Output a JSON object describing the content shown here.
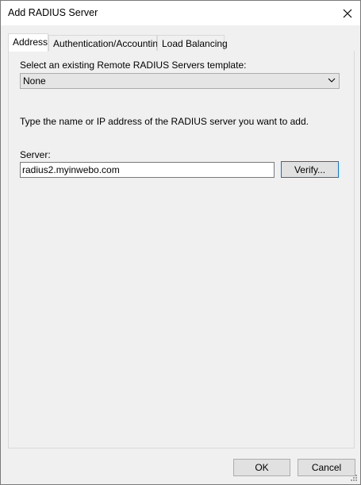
{
  "window": {
    "title": "Add RADIUS Server"
  },
  "tabs": [
    {
      "label": "Address",
      "active": true
    },
    {
      "label": "Authentication/Accounting",
      "active": false
    },
    {
      "label": "Load Balancing",
      "active": false
    }
  ],
  "address": {
    "template_label": "Select an existing Remote RADIUS Servers template:",
    "template_value": "None",
    "instruction": "Type the name or IP address of the RADIUS server you want to add.",
    "server_label": "Server:",
    "server_value": "radius2.myinwebo.com",
    "verify_label": "Verify..."
  },
  "footer": {
    "ok_label": "OK",
    "cancel_label": "Cancel"
  },
  "colors": {
    "dialog_bg": "#f0f0f0",
    "focus_accent": "#0078d7"
  },
  "icons": [
    "close-icon",
    "chevron-down-icon",
    "size-grip-icon"
  ]
}
